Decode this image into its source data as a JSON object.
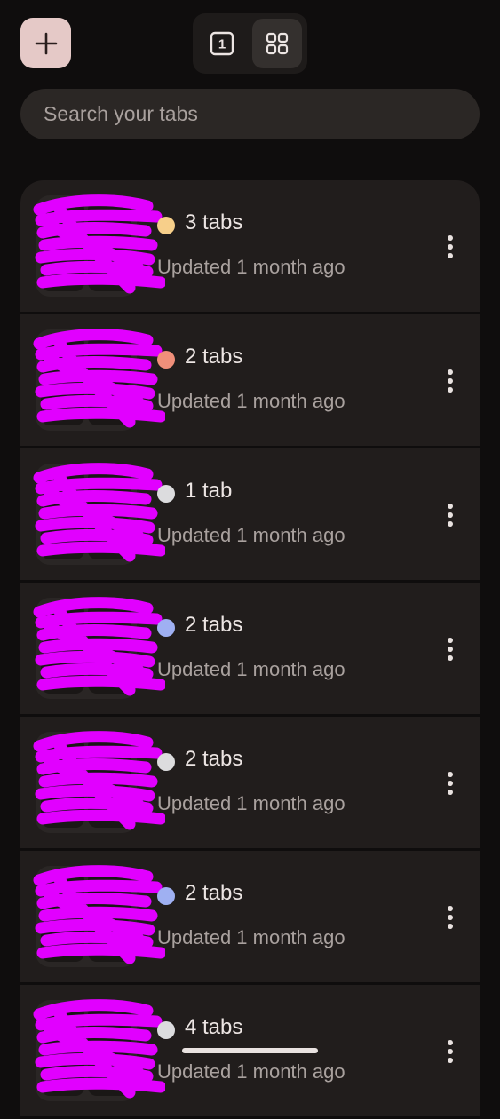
{
  "toolbar": {
    "new_tab_icon": "plus-icon",
    "tab_count_badge": "1",
    "grid_icon": "tab-groups-grid-icon"
  },
  "search": {
    "placeholder": "Search your tabs"
  },
  "groups": [
    {
      "count_label": "3 tabs",
      "updated": "Updated 1 month ago",
      "color": "#f7cf8a"
    },
    {
      "count_label": "2 tabs",
      "updated": "Updated 1 month ago",
      "color": "#f08f7a"
    },
    {
      "count_label": "1 tab",
      "updated": "Updated 1 month ago",
      "color": "#dcdcde"
    },
    {
      "count_label": "2 tabs",
      "updated": "Updated 1 month ago",
      "color": "#9fb0f2"
    },
    {
      "count_label": "2 tabs",
      "updated": "Updated 1 month ago",
      "color": "#dcdcde"
    },
    {
      "count_label": "2 tabs",
      "updated": "Updated 1 month ago",
      "color": "#9fb0f2"
    },
    {
      "count_label": "4 tabs",
      "updated": "Updated 1 month ago",
      "color": "#dcdcde"
    }
  ],
  "colors": {
    "background": "#0f0d0d",
    "card": "#211d1c",
    "accent_button": "#e5c9c7",
    "redaction": "#e100ff"
  }
}
